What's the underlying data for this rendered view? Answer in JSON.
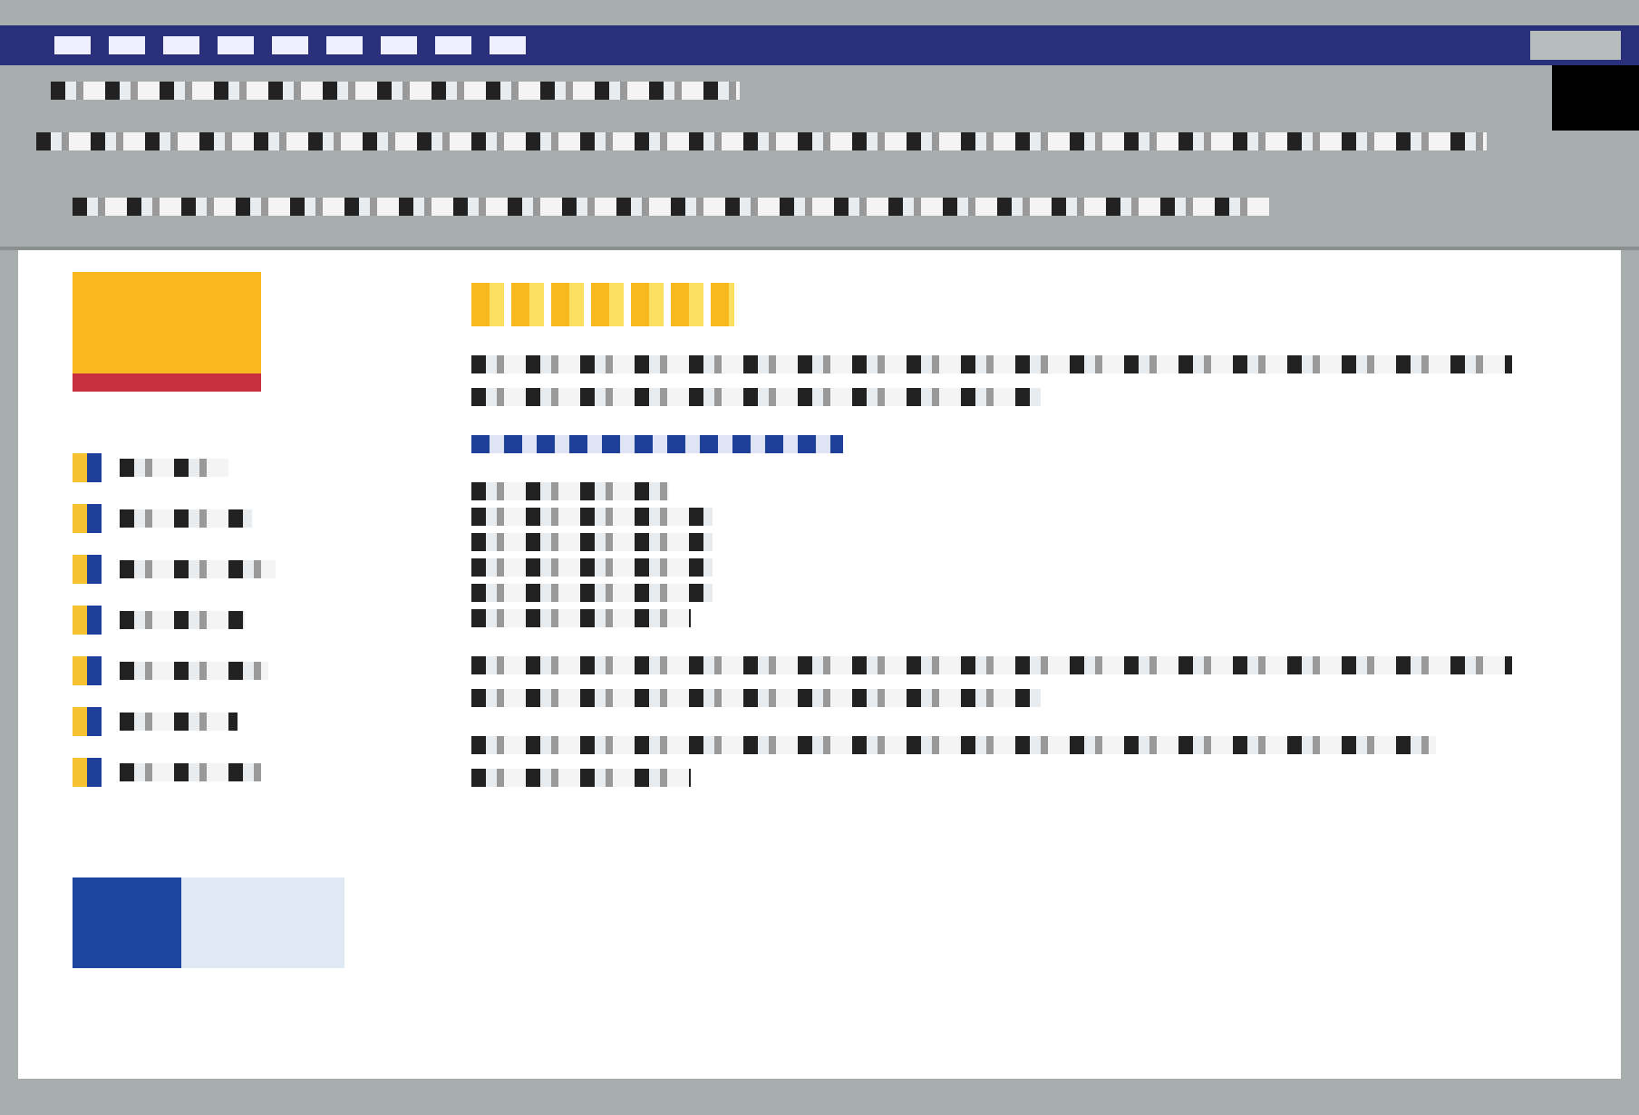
{
  "window": {
    "kind": "browser"
  },
  "sidebar": {
    "items": [
      {
        "kind": "entry"
      },
      {
        "kind": "entry"
      },
      {
        "kind": "entry"
      },
      {
        "kind": "entry"
      },
      {
        "kind": "entry"
      },
      {
        "kind": "entry"
      },
      {
        "kind": "entry"
      }
    ]
  },
  "content": {
    "blocks": [
      {
        "kind": "heading"
      },
      {
        "kind": "paragraph"
      },
      {
        "kind": "link"
      },
      {
        "kind": "list"
      },
      {
        "kind": "paragraph"
      },
      {
        "kind": "paragraph"
      }
    ]
  }
}
